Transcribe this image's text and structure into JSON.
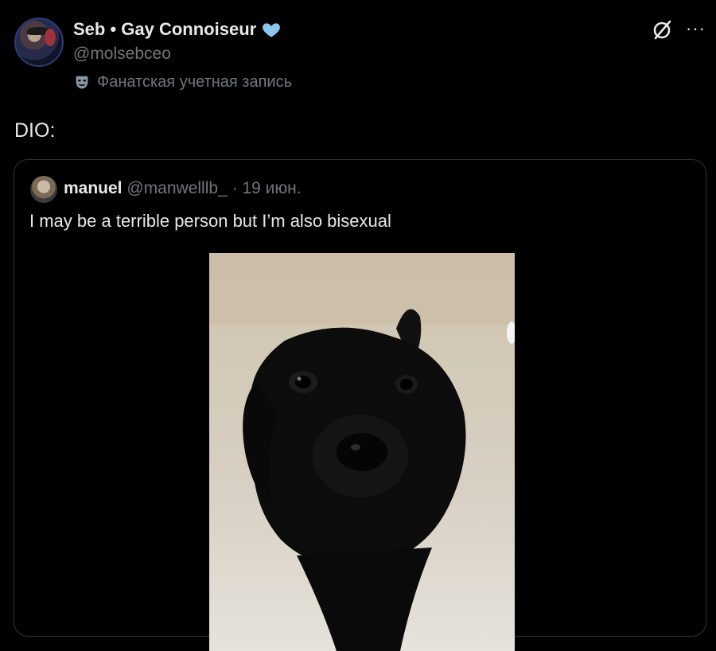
{
  "post": {
    "author": {
      "display_name": "Seb • Gay Connoiseur",
      "handle": "@molsebceo",
      "badge_icon": "blue-heart-icon",
      "badge_color": "#8ec5f0",
      "label": "Фанатская учетная запись",
      "label_icon": "theater-mask-icon"
    },
    "text": "DIO:",
    "actions": {
      "grok_icon": "grok-icon",
      "more_label": "···"
    }
  },
  "quoted_post": {
    "author": {
      "display_name": "manuel",
      "handle": "@manwelllb_"
    },
    "separator": "·",
    "date": "19 июн.",
    "text": "I may be a terrible person but I’m also bisexual",
    "media": {
      "type": "image",
      "subject": "black puppy"
    }
  },
  "colors": {
    "background": "#000000",
    "text_primary": "#e7e9ea",
    "text_secondary": "#71767b",
    "border": "#2f3336"
  }
}
